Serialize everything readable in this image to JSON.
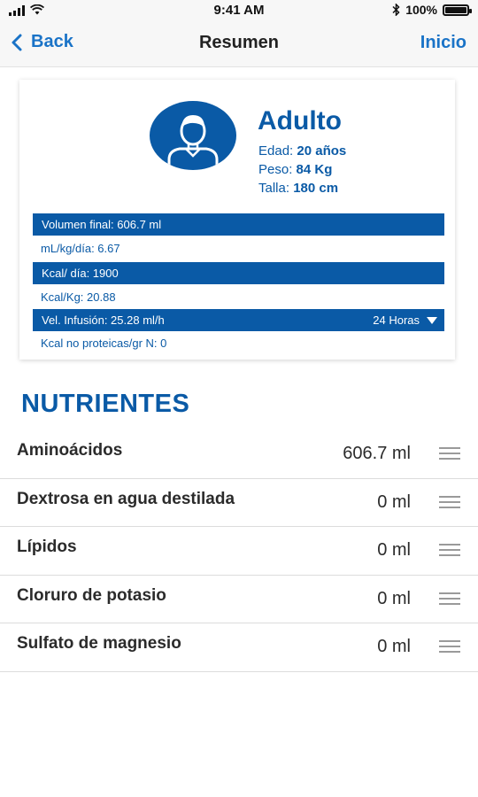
{
  "status_bar": {
    "time": "9:41 AM",
    "battery_text": "100%",
    "battery_level": 1.0
  },
  "nav": {
    "back_label": "Back",
    "title": "Resumen",
    "home_label": "Inicio"
  },
  "profile": {
    "type": "Adulto",
    "age_label": "Edad:",
    "age_value": "20 años",
    "weight_label": "Peso:",
    "weight_value": "84 Kg",
    "height_label": "Talla:",
    "height_value": "180 cm"
  },
  "summary": {
    "final_volume": "Volumen final: 606.7 ml",
    "ml_kg_day": "mL/kg/día: 6.67",
    "kcal_day": "Kcal/ día: 1900",
    "kcal_kg": "Kcal/Kg: 20.88",
    "infusion_rate": "Vel. Infusión: 25.28 ml/h",
    "infusion_period": "24 Horas",
    "kcal_non_protein": "Kcal no proteicas/gr N: 0"
  },
  "nutrients": {
    "title": "NUTRIENTES",
    "items": [
      {
        "name": "Aminoácidos",
        "value": "606.7 ml"
      },
      {
        "name": "Dextrosa en agua destilada",
        "value": "0 ml"
      },
      {
        "name": "Lípidos",
        "value": "0 ml"
      },
      {
        "name": "Cloruro de potasio",
        "value": "0 ml"
      },
      {
        "name": "Sulfato de magnesio",
        "value": "0 ml"
      }
    ]
  },
  "colors": {
    "accent": "#0a5aa6",
    "link": "#1a73c7",
    "text": "#2b2b2b"
  },
  "icons": {
    "back": "chevron-left-icon",
    "avatar": "user-avatar-icon",
    "dropdown": "triangle-down-icon",
    "reorder": "reorder-handle-icon"
  }
}
